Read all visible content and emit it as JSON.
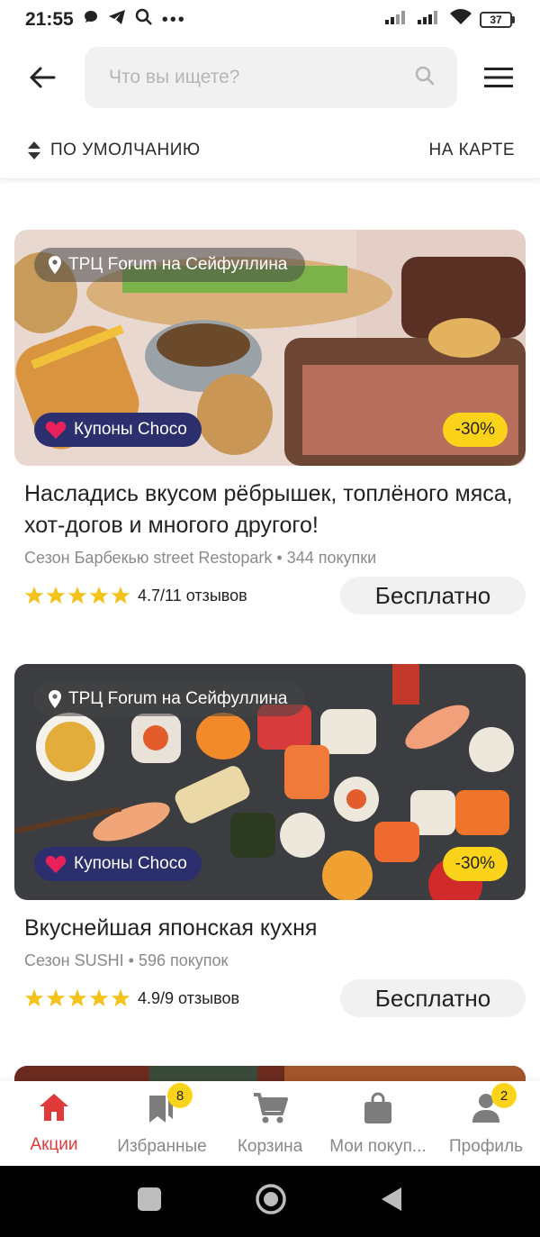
{
  "status_bar": {
    "time": "21:55",
    "battery": "37"
  },
  "search": {
    "placeholder": "Что вы ищете?"
  },
  "sort": {
    "label": "ПО УМОЛЧАНИЮ",
    "map_label": "НА КАРТЕ"
  },
  "colors": {
    "accent_red": "#e03a3a",
    "coupon_blue": "#2c2f6e",
    "badge_yellow": "#fbd31a"
  },
  "cards": [
    {
      "location": "ТРЦ Forum на Сейфуллина",
      "coupon": "Купоны Choco",
      "discount": "-30%",
      "title": "Насладись вкусом рёбрышек, топлёного мяса, хот-догов и многого другого!",
      "meta": "Сезон Барбекью street Restopark • 344 покупки",
      "rating_value": 4.7,
      "rating_text": "4.7/11 отзывов",
      "price": "Бесплатно"
    },
    {
      "location": "ТРЦ Forum на Сейфуллина",
      "coupon": "Купоны Choco",
      "discount": "-30%",
      "title": "Вкуснейшая японская кухня",
      "meta": "Сезон SUSHI • 596 покупок",
      "rating_value": 4.9,
      "rating_text": "4.9/9 отзывов",
      "price": "Бесплатно"
    }
  ],
  "tabs": [
    {
      "label": "Акции",
      "icon": "home-icon",
      "active": true
    },
    {
      "label": "Избранные",
      "icon": "bookmarks-icon",
      "badge": "8"
    },
    {
      "label": "Корзина",
      "icon": "cart-icon"
    },
    {
      "label": "Мои покуп...",
      "icon": "bag-icon"
    },
    {
      "label": "Профиль",
      "icon": "person-icon",
      "badge": "2"
    }
  ]
}
